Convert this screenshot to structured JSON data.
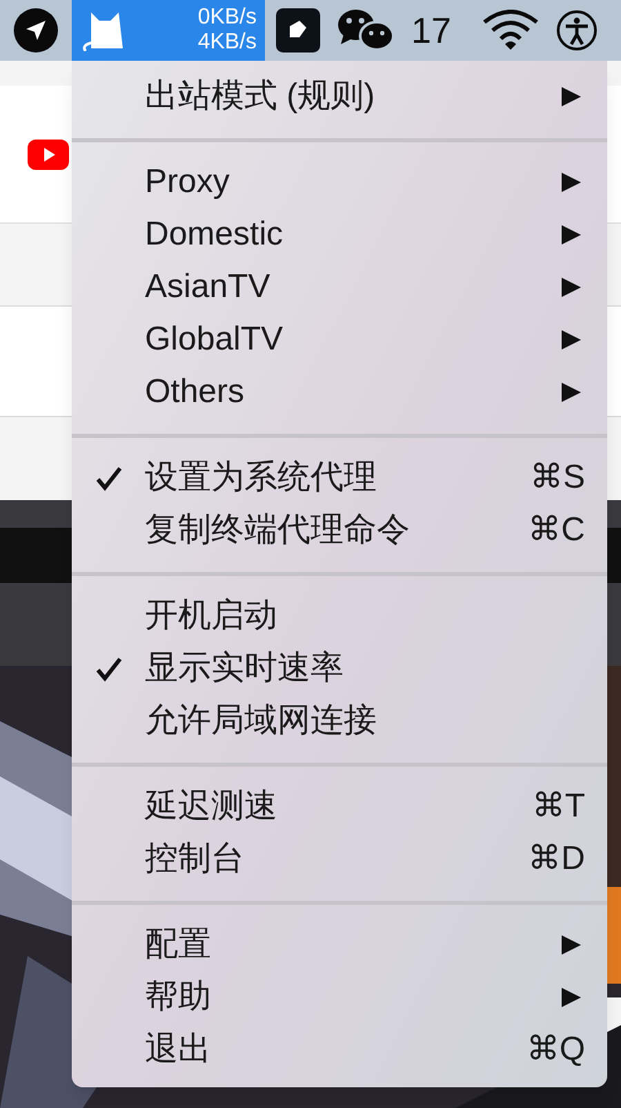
{
  "menu_bar": {
    "clashx": {
      "selected": true,
      "upload": "0KB/s",
      "download": "4KB/s"
    },
    "count": "17"
  },
  "menu": {
    "sections": [
      {
        "items": [
          {
            "kind": "submenu",
            "label": "出站模式 (规则)",
            "checked": false
          }
        ]
      },
      {
        "items": [
          {
            "kind": "submenu",
            "label": "Proxy",
            "checked": false
          },
          {
            "kind": "submenu",
            "label": "Domestic",
            "checked": false
          },
          {
            "kind": "submenu",
            "label": "AsianTV",
            "checked": false
          },
          {
            "kind": "submenu",
            "label": "GlobalTV",
            "checked": false
          },
          {
            "kind": "submenu",
            "label": "Others",
            "checked": false
          }
        ]
      },
      {
        "items": [
          {
            "kind": "shortcut",
            "label": "设置为系统代理",
            "checked": true,
            "shortcut": "⌘S"
          },
          {
            "kind": "shortcut",
            "label": "复制终端代理命令",
            "checked": false,
            "shortcut": "⌘C"
          }
        ]
      },
      {
        "items": [
          {
            "kind": "plain",
            "label": "开机启动",
            "checked": false
          },
          {
            "kind": "plain",
            "label": "显示实时速率",
            "checked": true
          },
          {
            "kind": "plain",
            "label": "允许局域网连接",
            "checked": false
          }
        ]
      },
      {
        "items": [
          {
            "kind": "shortcut",
            "label": "延迟测速",
            "checked": false,
            "shortcut": "⌘T"
          },
          {
            "kind": "shortcut",
            "label": "控制台",
            "checked": false,
            "shortcut": "⌘D"
          }
        ]
      },
      {
        "items": [
          {
            "kind": "submenu",
            "label": "配置",
            "checked": false
          },
          {
            "kind": "submenu",
            "label": "帮助",
            "checked": false
          },
          {
            "kind": "shortcut",
            "label": "退出",
            "checked": false,
            "shortcut": "⌘Q"
          }
        ]
      }
    ]
  }
}
